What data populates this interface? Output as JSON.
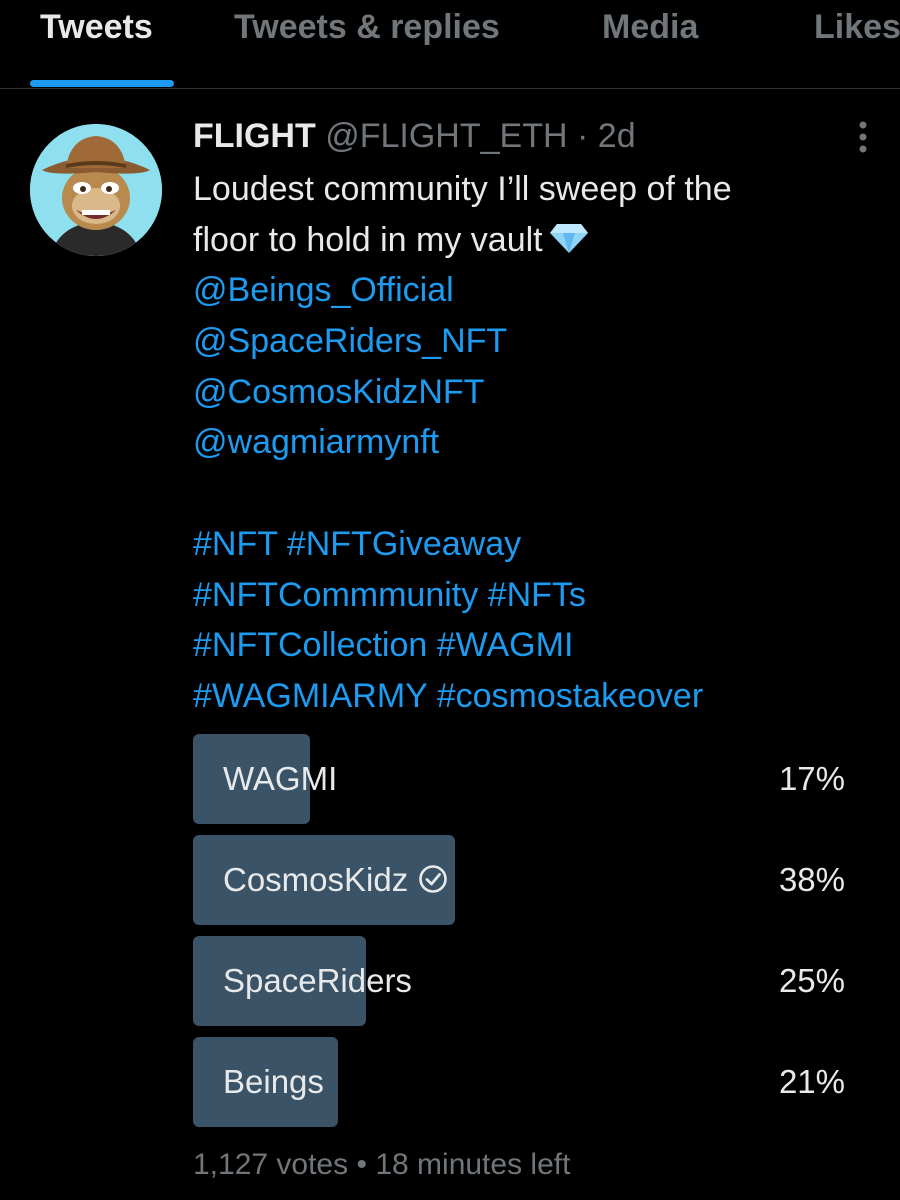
{
  "tabs": [
    {
      "label": "Tweets",
      "active": true
    },
    {
      "label": "Tweets & replies",
      "active": false
    },
    {
      "label": "Media",
      "active": false
    },
    {
      "label": "Likes",
      "active": false
    }
  ],
  "tweet": {
    "author_name": "FLIGHT",
    "handle": "@FLIGHT_ETH",
    "separator": "·",
    "time": "2d",
    "text_line1": "Loudest community I’ll sweep of the",
    "text_line2": "floor to hold in my vault",
    "emoji": "diamond-icon",
    "mentions": [
      "@Beings_Official",
      "@SpaceRiders_NFT",
      "@CosmosKidzNFT",
      "@wagmiarmynft"
    ],
    "hashtag_lines": [
      [
        "#NFT",
        "#NFTGiveaway"
      ],
      [
        "#NFTCommmunity",
        "#NFTs"
      ],
      [
        "#NFTCollection",
        "#WAGMI"
      ],
      [
        "#WAGMIARMY",
        "#cosmostakeover"
      ]
    ]
  },
  "poll": {
    "options": [
      {
        "label": "WAGMI",
        "percent": 17,
        "percent_label": "17%",
        "selected": false
      },
      {
        "label": "CosmosKidz",
        "percent": 38,
        "percent_label": "38%",
        "selected": true
      },
      {
        "label": "SpaceRiders",
        "percent": 25,
        "percent_label": "25%",
        "selected": false
      },
      {
        "label": "Beings",
        "percent": 21,
        "percent_label": "21%",
        "selected": false
      }
    ],
    "votes": "1,127 votes",
    "dot": "•",
    "time_left": "18 minutes left"
  },
  "colors": {
    "background": "#000000",
    "text": "#e7e9ea",
    "muted": "#71767b",
    "link": "#1d9bf0",
    "poll_bar": "#3a5366"
  }
}
